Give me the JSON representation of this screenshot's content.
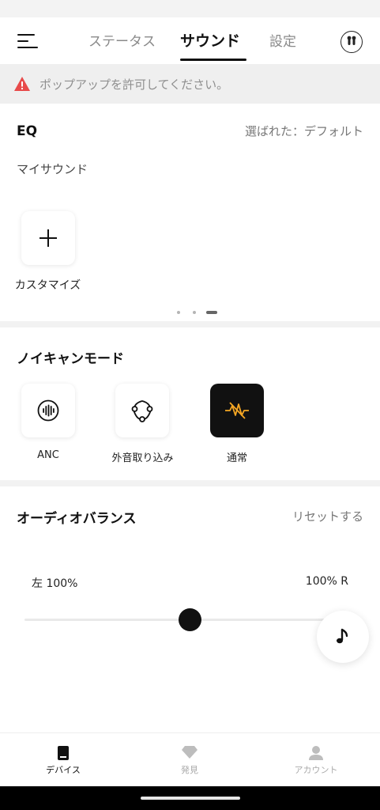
{
  "header": {
    "tabs": [
      {
        "label": "ステータス",
        "active": false
      },
      {
        "label": "サウンド",
        "active": true
      },
      {
        "label": "設定",
        "active": false
      }
    ]
  },
  "banner": {
    "text": "ポップアップを許可してください。",
    "icon": "warning-icon",
    "icon_color": "#e84a4a"
  },
  "eq": {
    "title": "EQ",
    "selected_text": "選ばれた：デフォルト",
    "subtitle": "マイサウンド",
    "customize_label": "カスタマイズ",
    "page_indicator": {
      "pages": 3,
      "current": 3
    }
  },
  "noise_mode": {
    "title": "ノイキャンモード",
    "options": [
      {
        "label": "ANC",
        "icon": "anc-waveform-icon",
        "selected": false
      },
      {
        "label": "外音取り込み",
        "icon": "transparency-icon",
        "selected": false
      },
      {
        "label": "通常",
        "icon": "normal-mode-icon",
        "selected": true
      }
    ],
    "accent_color": "#f5a623"
  },
  "audio_balance": {
    "title": "オーディオバランス",
    "reset_label": "リセットする",
    "left_label": "左 100%",
    "right_label": "100% R",
    "balance_value": 0
  },
  "bottom_nav": {
    "items": [
      {
        "label": "デバイス",
        "icon": "device-icon",
        "active": true
      },
      {
        "label": "発見",
        "icon": "discover-diamond-icon",
        "active": false
      },
      {
        "label": "アカウント",
        "icon": "account-icon",
        "active": false
      }
    ]
  }
}
